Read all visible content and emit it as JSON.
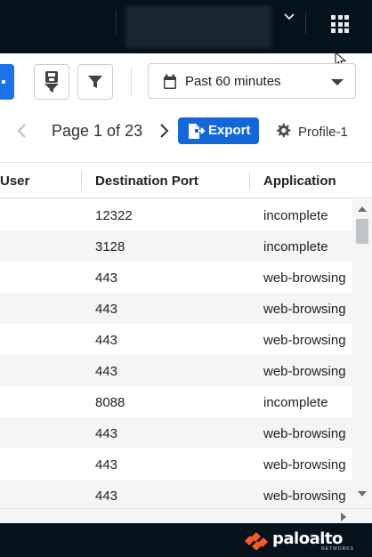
{
  "header": {
    "tenant_name": "",
    "icons": {
      "tenant_dropdown": "chevron-down-icon",
      "apps": "apps-grid-icon"
    }
  },
  "toolbar": {
    "icons": {
      "save_filter": "save-filter-icon",
      "filter": "filter-icon",
      "calendar": "calendar-icon"
    },
    "time_range": "Past 60 minutes"
  },
  "pager": {
    "label": "Page 1 of 23",
    "export_label": "Export",
    "profile_label": "Profile-1"
  },
  "table": {
    "columns": [
      "User",
      "Destination Port",
      "Application"
    ],
    "rows": [
      {
        "port": "12322",
        "app": "incomplete"
      },
      {
        "port": "3128",
        "app": "incomplete"
      },
      {
        "port": "443",
        "app": "web-browsing"
      },
      {
        "port": "443",
        "app": "web-browsing"
      },
      {
        "port": "443",
        "app": "web-browsing"
      },
      {
        "port": "443",
        "app": "web-browsing"
      },
      {
        "port": "8088",
        "app": "incomplete"
      },
      {
        "port": "443",
        "app": "web-browsing"
      },
      {
        "port": "443",
        "app": "web-browsing"
      },
      {
        "port": "443",
        "app": "web-browsing"
      }
    ]
  },
  "footer": {
    "logo_text": "paloalto",
    "logo_subtext": "NETWORKS"
  },
  "colors": {
    "topbar": "#05121c",
    "accent_blue": "#1467d8",
    "logo_orange": "#fa582d"
  }
}
